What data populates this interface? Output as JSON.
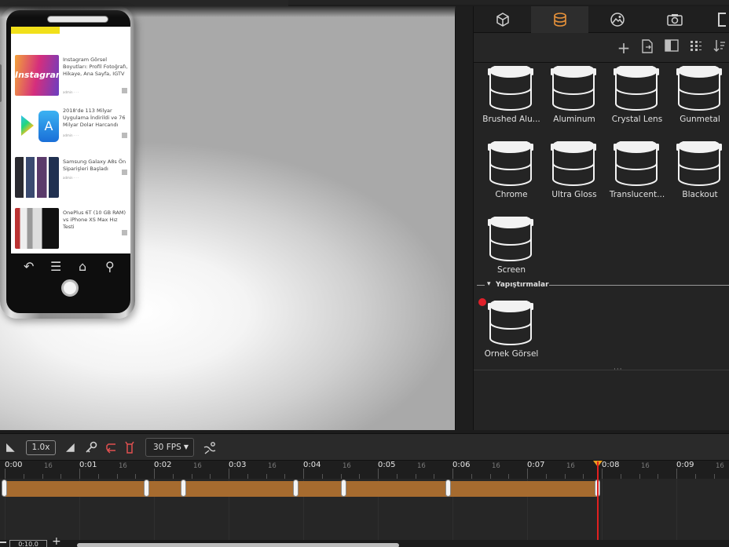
{
  "materials": [
    {
      "label": "Brushed Alu..."
    },
    {
      "label": "Aluminum"
    },
    {
      "label": "Crystal Lens"
    },
    {
      "label": "Gunmetal"
    },
    {
      "label": "Chrome"
    },
    {
      "label": "Ultra Gloss"
    },
    {
      "label": "Translucent..."
    },
    {
      "label": "Blackout"
    },
    {
      "label": "Screen"
    }
  ],
  "section": {
    "title": "Yapıştırmalar"
  },
  "stickers": [
    {
      "label": "Örnek Görsel"
    }
  ],
  "panel_tabs": [
    {
      "icon": "cube-icon"
    },
    {
      "icon": "material-icon"
    },
    {
      "icon": "image-icon"
    },
    {
      "icon": "camera-icon"
    }
  ],
  "toolbar_icons": [
    "add-icon",
    "import-icon",
    "layout-icon",
    "list-icon",
    "sort-icon"
  ],
  "timeline": {
    "speed": "1.0x",
    "fps": "30 FPS",
    "current_time": "0:10.0",
    "ticks": [
      "0:00",
      "0:01",
      "0:02",
      "0:03",
      "0:04",
      "0:05",
      "0:06",
      "0:07",
      "0:08",
      "0:09"
    ],
    "subtick": "16",
    "keyframe_times": [
      0.0,
      1.9,
      2.4,
      3.9,
      4.55,
      5.95,
      7.95
    ],
    "playhead_time": 7.95
  },
  "phone_screen": {
    "articles": [
      {
        "title": "Instagram Görsel Boyutları: Profil Fotoğrafı, Hikaye, Ana Sayfa, IGTV",
        "meta": "admin  ·  ·  ·",
        "thumb": "Instagram"
      },
      {
        "title": "2018'de 113 Milyar Uygulama İndirildi ve 76 Milyar Dolar Harcandı",
        "meta": "admin  ·  ·  ·",
        "thumb": "A"
      },
      {
        "title": "Samsung Galaxy A8s Ön Siparişleri Başladı",
        "meta": "admin  ·  ·  ·",
        "thumb": ""
      },
      {
        "title": "OnePlus 6T (10 GB RAM) vs iPhone XS Max Hız Testi",
        "meta": "admin  ·  ·  ·",
        "thumb": ""
      }
    ]
  },
  "colors": {
    "accent": "#e8923a",
    "keyframe_bar": "#a66b2f",
    "playhead": "#e02020"
  }
}
